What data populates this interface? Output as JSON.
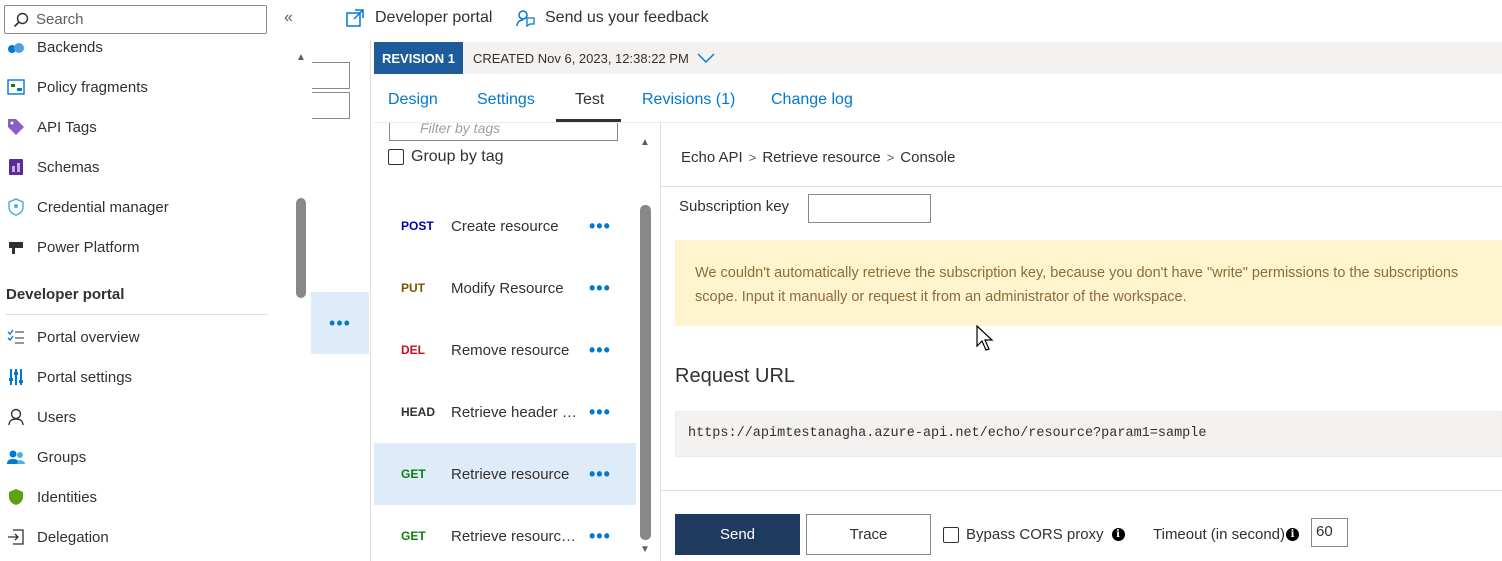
{
  "topbar": {
    "search_placeholder": "Search",
    "collapse_glyph": "«",
    "developer_portal": "Developer portal",
    "feedback": "Send us your feedback"
  },
  "sidebar": {
    "items_top": [
      {
        "label": "Backends",
        "icon": "backends-icon"
      },
      {
        "label": "Policy fragments",
        "icon": "policy-fragments-icon"
      },
      {
        "label": "API Tags",
        "icon": "tag-icon"
      },
      {
        "label": "Schemas",
        "icon": "schemas-icon"
      },
      {
        "label": "Credential manager",
        "icon": "credential-icon"
      },
      {
        "label": "Power Platform",
        "icon": "power-platform-icon"
      }
    ],
    "section_title": "Developer portal",
    "items_bottom": [
      {
        "label": "Portal overview",
        "icon": "list-check-icon"
      },
      {
        "label": "Portal settings",
        "icon": "sliders-icon"
      },
      {
        "label": "Users",
        "icon": "user-icon"
      },
      {
        "label": "Groups",
        "icon": "group-icon"
      },
      {
        "label": "Identities",
        "icon": "shield-icon"
      },
      {
        "label": "Delegation",
        "icon": "delegation-icon"
      }
    ]
  },
  "revision": {
    "badge": "REVISION 1",
    "created": "CREATED Nov 6, 2023, 12:38:22 PM"
  },
  "tabs": [
    "Design",
    "Settings",
    "Test",
    "Revisions (1)",
    "Change log"
  ],
  "active_tab": "Test",
  "operations": {
    "filter_placeholder": "Filter by tags",
    "group_by_tag": "Group by tag",
    "items": [
      {
        "verb": "POST",
        "name": "Create resource",
        "color": "#0000b3"
      },
      {
        "verb": "PUT",
        "name": "Modify Resource",
        "color": "#7a5300"
      },
      {
        "verb": "DEL",
        "name": "Remove resource",
        "color": "#c50f1f"
      },
      {
        "verb": "HEAD",
        "name": "Retrieve header only",
        "color": "#323130"
      },
      {
        "verb": "GET",
        "name": "Retrieve resource",
        "color": "#107c10",
        "selected": true
      },
      {
        "verb": "GET",
        "name": "Retrieve resource (cached)",
        "color": "#107c10"
      }
    ],
    "more_glyph": "•••"
  },
  "console": {
    "breadcrumb": [
      "Echo API",
      "Retrieve resource",
      "Console"
    ],
    "subscription_label": "Subscription key",
    "warning": "We couldn't automatically retrieve the subscription key, because you don't have \"write\" permissions to the subscriptions scope. Input it manually or request it from an administrator of the workspace.",
    "request_url_title": "Request URL",
    "request_url": "https://apimtestanagha.azure-api.net/echo/resource?param1=sample",
    "send": "Send",
    "trace": "Trace",
    "bypass_cors": "Bypass CORS proxy",
    "timeout_label": "Timeout (in second)",
    "timeout_value": "60"
  }
}
